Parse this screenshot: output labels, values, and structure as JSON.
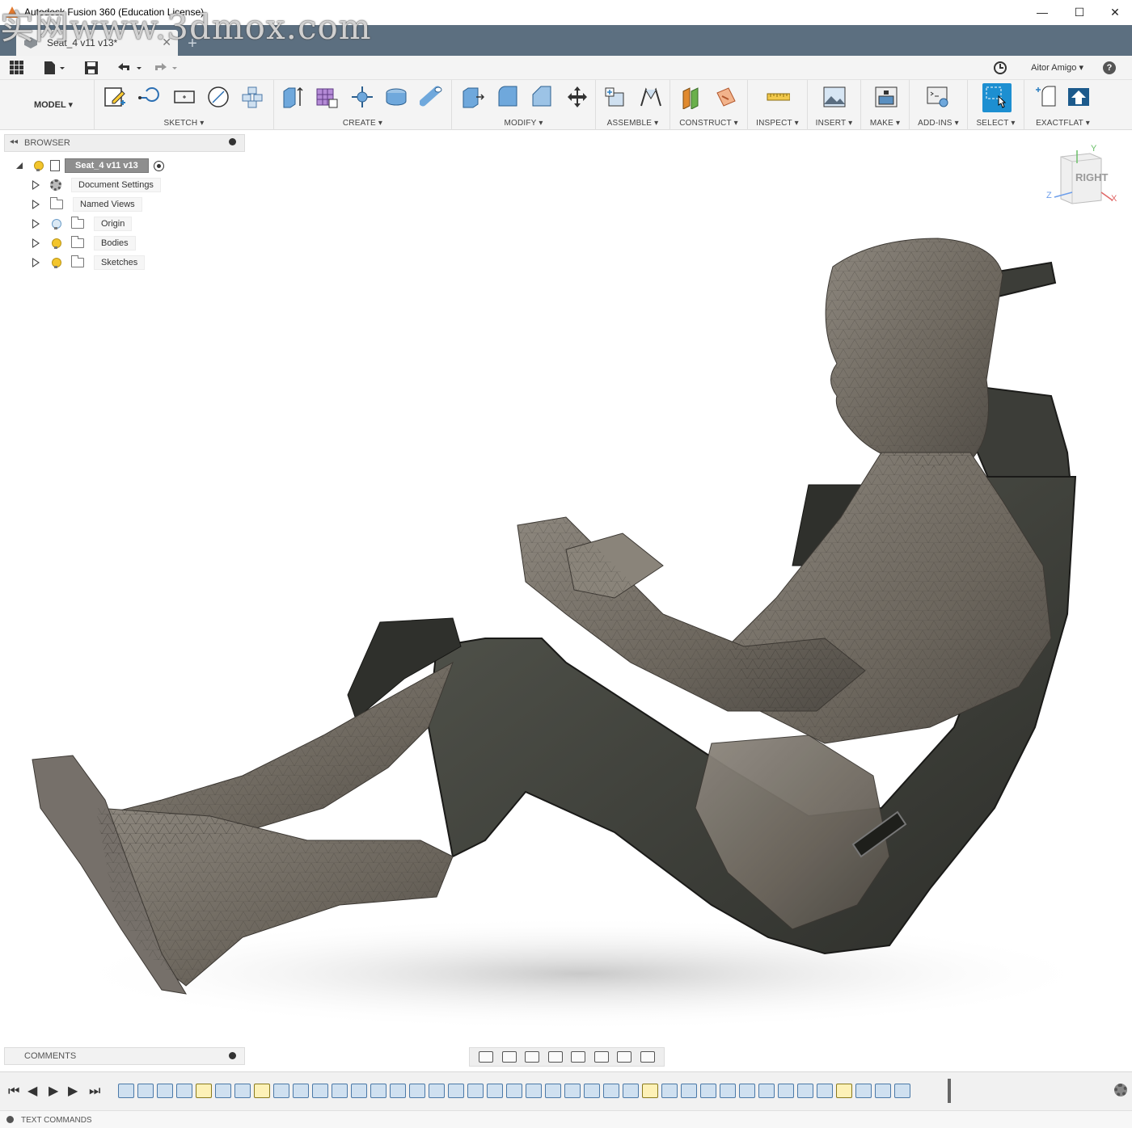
{
  "window": {
    "title": "Autodesk Fusion 360 (Education License)",
    "watermark": "实网www.3dmox.com",
    "minimize": "—",
    "maximize": "☐",
    "close": "✕"
  },
  "tab": {
    "label": "Seat_4 v11 v13*",
    "close": "✕",
    "new": "+"
  },
  "quick_access": {
    "user": "Aitor Amigo ▾",
    "help": "?"
  },
  "toolbar": {
    "workspace": "MODEL ▾",
    "groups": [
      {
        "label": "SKETCH ▾"
      },
      {
        "label": "CREATE ▾"
      },
      {
        "label": "MODIFY ▾"
      },
      {
        "label": "ASSEMBLE ▾"
      },
      {
        "label": "CONSTRUCT ▾"
      },
      {
        "label": "INSPECT ▾"
      },
      {
        "label": "INSERT ▾"
      },
      {
        "label": "MAKE ▾"
      },
      {
        "label": "ADD-INS ▾"
      },
      {
        "label": "SELECT ▾"
      },
      {
        "label": "EXACTFLAT ▾"
      }
    ]
  },
  "browser": {
    "title": "BROWSER",
    "root": "Seat_4 v11 v13",
    "items": [
      {
        "label": "Document Settings"
      },
      {
        "label": "Named Views"
      },
      {
        "label": "Origin"
      },
      {
        "label": "Bodies"
      },
      {
        "label": "Sketches"
      }
    ]
  },
  "viewcube": {
    "face": "RIGHT",
    "axis_y": "Y",
    "axis_z": "Z",
    "axis_x": "X"
  },
  "comments": {
    "title": "COMMENTS"
  },
  "text_commands": {
    "title": "TEXT COMMANDS"
  },
  "colors": {
    "tab_strip": "#5c6f80",
    "select_accent": "#1d8fd1",
    "mesh": "#6f6a62",
    "seat": "#3a3b36"
  }
}
